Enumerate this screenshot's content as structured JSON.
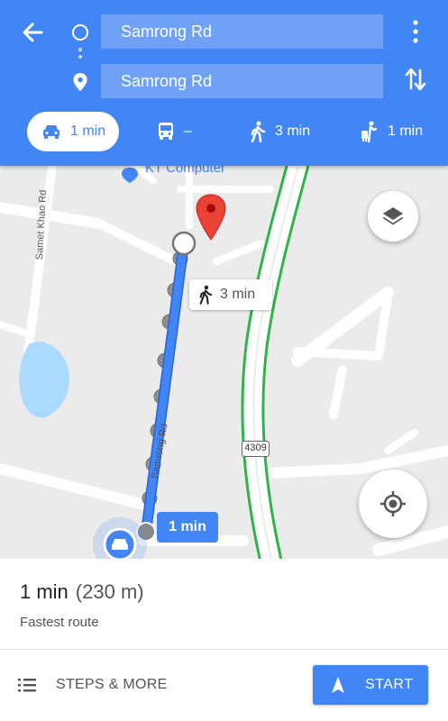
{
  "header": {
    "from_value": "Samrong Rd",
    "to_value": "Samrong Rd",
    "icons": {
      "back": "back-arrow-icon",
      "origin": "origin-circle-icon",
      "destination": "destination-pin-icon",
      "more": "more-vert-icon",
      "swap": "swap-vertical-icon"
    },
    "modes": [
      {
        "id": "drive",
        "label": "1 min",
        "icon": "car-icon",
        "selected": true
      },
      {
        "id": "transit",
        "label": "–",
        "icon": "bus-icon",
        "selected": false
      },
      {
        "id": "walk",
        "label": "3 min",
        "icon": "walk-icon",
        "selected": false
      },
      {
        "id": "ride",
        "label": "1 min",
        "icon": "ride-icon",
        "selected": false
      }
    ]
  },
  "map": {
    "poi_label": "KT Computer",
    "road_labels": [
      "Samet Khao Rd",
      "Samrong Rd"
    ],
    "route_shield": "4309",
    "walk_chip": "3 min",
    "drive_chip": "1 min",
    "icons": {
      "layers": "layers-icon",
      "locate": "my-location-icon",
      "marker": "red-pin-icon",
      "car": "car-icon"
    }
  },
  "sheet": {
    "duration": "1 min",
    "distance": "(230 m)",
    "subtitle": "Fastest route",
    "steps_label": "STEPS & MORE",
    "start_label": "START"
  },
  "colors": {
    "primary": "#4285f4",
    "map_bg": "#ebebeb",
    "road": "#ffffff",
    "route": "#4285f4",
    "highway_edge": "#2fb34a",
    "marker": "#ea4335"
  }
}
